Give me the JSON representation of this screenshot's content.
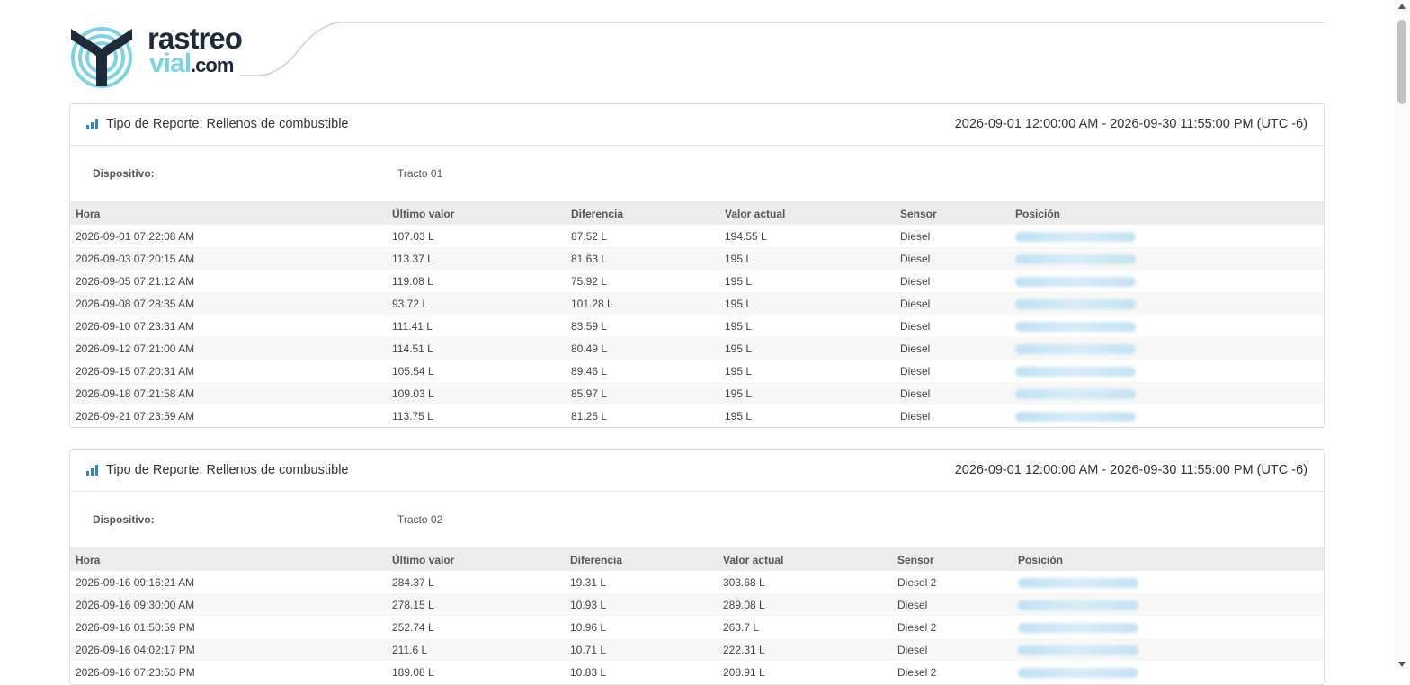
{
  "logo": {
    "line1": "rastreo",
    "line2": "vial",
    "line2_suffix": ".com"
  },
  "colors": {
    "brand_dark": "#1f2a3a",
    "brand_light": "#7ed3e2",
    "accent": "#2b86c5"
  },
  "columns": [
    "Hora",
    "Último valor",
    "Diferencia",
    "Valor actual",
    "Sensor",
    "Posición"
  ],
  "reports": [
    {
      "title": "Tipo de Reporte: Rellenos de combustible",
      "range": "2026-09-01 12:00:00 AM - 2026-09-30 11:55:00 PM (UTC -6)",
      "device_label": "Dispositivo:",
      "device_value": "Tracto 01",
      "rows": [
        [
          "2026-09-01 07:22:08 AM",
          "107.03 L",
          "87.52 L",
          "194.55 L",
          "Diesel"
        ],
        [
          "2026-09-03 07:20:15 AM",
          "113.37 L",
          "81.63 L",
          "195 L",
          "Diesel"
        ],
        [
          "2026-09-05 07:21:12 AM",
          "119.08 L",
          "75.92 L",
          "195 L",
          "Diesel"
        ],
        [
          "2026-09-08 07:28:35 AM",
          "93.72 L",
          "101.28 L",
          "195 L",
          "Diesel"
        ],
        [
          "2026-09-10 07:23:31 AM",
          "111.41 L",
          "83.59 L",
          "195 L",
          "Diesel"
        ],
        [
          "2026-09-12 07:21:00 AM",
          "114.51 L",
          "80.49 L",
          "195 L",
          "Diesel"
        ],
        [
          "2026-09-15 07:20:31 AM",
          "105.54 L",
          "89.46 L",
          "195 L",
          "Diesel"
        ],
        [
          "2026-09-18 07:21:58 AM",
          "109.03 L",
          "85.97 L",
          "195 L",
          "Diesel"
        ],
        [
          "2026-09-21 07:23:59 AM",
          "113.75 L",
          "81.25 L",
          "195 L",
          "Diesel"
        ]
      ]
    },
    {
      "title": "Tipo de Reporte: Rellenos de combustible",
      "range": "2026-09-01 12:00:00 AM - 2026-09-30 11:55:00 PM (UTC -6)",
      "device_label": "Dispositivo:",
      "device_value": "Tracto 02",
      "rows": [
        [
          "2026-09-16 09:16:21 AM",
          "284.37 L",
          "19.31 L",
          "303.68 L",
          "Diesel 2"
        ],
        [
          "2026-09-16 09:30:00 AM",
          "278.15 L",
          "10.93 L",
          "289.08 L",
          "Diesel"
        ],
        [
          "2026-09-16 01:50:59 PM",
          "252.74 L",
          "10.96 L",
          "263.7 L",
          "Diesel 2"
        ],
        [
          "2026-09-16 04:02:17 PM",
          "211.6 L",
          "10.71 L",
          "222.31 L",
          "Diesel"
        ],
        [
          "2026-09-16 07:23:53 PM",
          "189.08 L",
          "10.83 L",
          "208.91 L",
          "Diesel 2"
        ]
      ]
    }
  ]
}
